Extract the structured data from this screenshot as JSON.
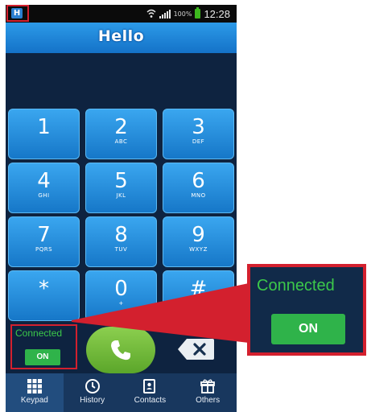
{
  "status_bar": {
    "app_icon": "H",
    "battery_percent": "100%",
    "time": "12:28"
  },
  "app": {
    "title": "Hello"
  },
  "keypad": {
    "keys": [
      {
        "digit": "1",
        "letters": ""
      },
      {
        "digit": "2",
        "letters": "ABC"
      },
      {
        "digit": "3",
        "letters": "DEF"
      },
      {
        "digit": "4",
        "letters": "GHI"
      },
      {
        "digit": "5",
        "letters": "JKL"
      },
      {
        "digit": "6",
        "letters": "MNO"
      },
      {
        "digit": "7",
        "letters": "PQRS"
      },
      {
        "digit": "8",
        "letters": "TUV"
      },
      {
        "digit": "9",
        "letters": "WXYZ"
      },
      {
        "digit": "*",
        "letters": ""
      },
      {
        "digit": "0",
        "letters": "+"
      },
      {
        "digit": "#",
        "letters": ""
      }
    ]
  },
  "connection": {
    "status": "Connected",
    "toggle": "ON",
    "status_color": "#3cc84a",
    "toggle_color": "#2fb34a"
  },
  "nav": {
    "tabs": [
      {
        "label": "Keypad",
        "icon": "keypad-icon",
        "active": true
      },
      {
        "label": "History",
        "icon": "clock-icon",
        "active": false
      },
      {
        "label": "Contacts",
        "icon": "contacts-book-icon",
        "active": false
      },
      {
        "label": "Others",
        "icon": "gift-icon",
        "active": false
      }
    ]
  },
  "colors": {
    "key_top": "#3aa6ef",
    "key_bottom": "#1677c8",
    "call_button": "#6fb93a",
    "highlight": "#d3202e",
    "background": "#0e2340"
  }
}
